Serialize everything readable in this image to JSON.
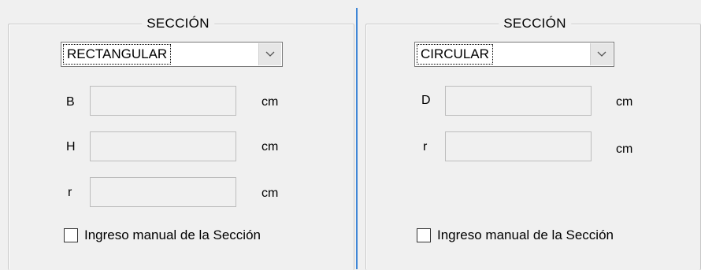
{
  "left_panel": {
    "legend": "SECCIÓN",
    "section_select": {
      "value": "RECTANGULAR",
      "icon": "chevron-down-icon"
    },
    "fields": [
      {
        "label": "B",
        "value": "",
        "unit": "cm"
      },
      {
        "label": "H",
        "value": "",
        "unit": "cm"
      },
      {
        "label": "r",
        "value": "",
        "unit": "cm"
      }
    ],
    "manual_checkbox": {
      "label": "Ingreso manual de la Sección",
      "checked": false
    }
  },
  "right_panel": {
    "legend": "SECCIÓN",
    "section_select": {
      "value": "CIRCULAR",
      "icon": "chevron-down-icon"
    },
    "fields": [
      {
        "label": "D",
        "value": "",
        "unit": "cm"
      },
      {
        "label": "r",
        "value": "",
        "unit": "cm"
      }
    ],
    "manual_checkbox": {
      "label": "Ingreso manual de la Sección",
      "checked": false
    }
  },
  "colors": {
    "background": "#f0f0f0",
    "splitter": "#3f86d6",
    "groupbox_border": "#c8c8c8"
  }
}
